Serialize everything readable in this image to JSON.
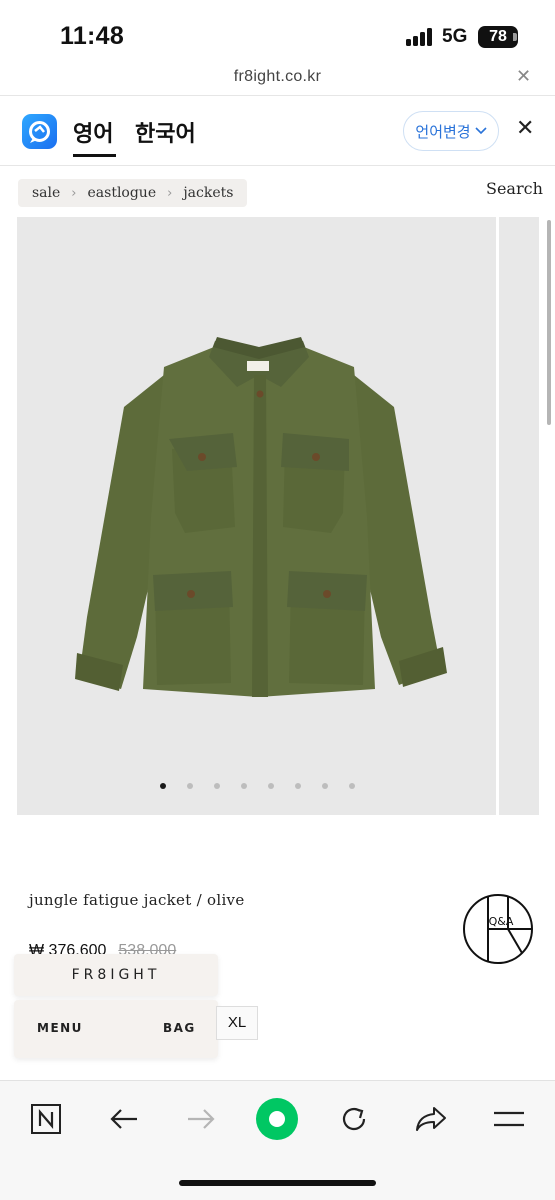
{
  "status_bar": {
    "time": "11:48",
    "network": "5G",
    "battery": "78"
  },
  "browser": {
    "url": "fr8ight.co.kr",
    "close_icon": "close-icon"
  },
  "translate_bar": {
    "tabs": [
      {
        "label": "영어",
        "active": true
      },
      {
        "label": "한국어",
        "active": false
      }
    ],
    "change_language_label": "언어변경",
    "accent_color": "#2a73d9"
  },
  "breadcrumb": {
    "items": [
      "sale",
      "eastlogue",
      "jackets"
    ]
  },
  "search_label": "Search",
  "gallery": {
    "image_count": 8,
    "active_index": 0,
    "background": "#e8e8e8"
  },
  "product": {
    "title": "jungle fatigue jacket / olive",
    "price_sale": "₩ 376,600",
    "price_original": "538,000",
    "size": "XL",
    "qa_label": "Q&A"
  },
  "fr8ight_nav": {
    "brand": "FR8IGHT",
    "menu_label": "MENU",
    "bag_label": "BAG"
  },
  "toolbar": {
    "items": [
      "naver-icon",
      "back-arrow-icon",
      "forward-arrow-icon",
      "green-dot-button",
      "refresh-icon",
      "share-icon",
      "menu-icon"
    ],
    "accent_color": "#00c763"
  }
}
